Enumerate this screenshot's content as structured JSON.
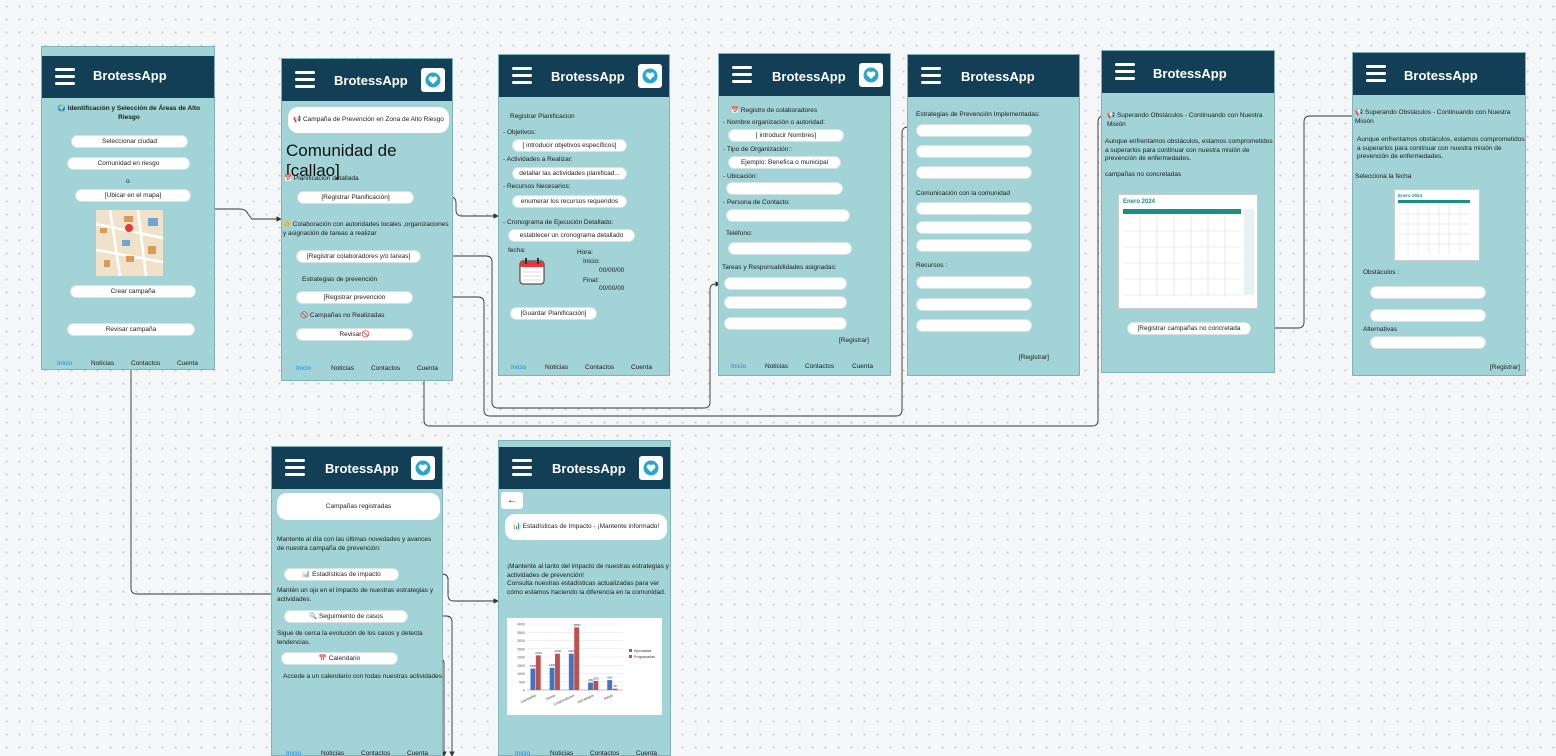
{
  "app_name": "BrotessApp",
  "nav": {
    "inicio": "Inicio",
    "noticias": "Noticias",
    "contactos": "Contactos",
    "cuenta": "Cuenta"
  },
  "colors": {
    "header": "#123f55",
    "screen_bg": "#a2d3d6",
    "active_nav": "#1e88e5"
  },
  "s1": {
    "heading": "🌍 Identificación y Selección de Áreas de Alto Riesgo",
    "btn_city": "Seleccionar ciudad",
    "btn_community": "Comunidad en riesgo",
    "or": "o",
    "btn_map": "[Ubicar en el mapa]",
    "btn_create": "Crear campaña",
    "btn_review": "Revisar campaña"
  },
  "s2": {
    "banner": "📢 Campaña de Prevención en Zona de Alto Riesgo",
    "community": "Comunidad de [callao]",
    "plan_label": "📅 Planificación detallada",
    "btn_plan": "[Registrar Planificación]",
    "collab_label": "🤝 Colaboración con autoridades locales ,organizaciones y asignación de tareas a realizar",
    "btn_collab": "[Registrar colaboradores y/o tareas]",
    "strat_label": "Estrategias de prevención",
    "btn_strat": "[Registrar prevencion",
    "failed_label": "🚫 Campañas no Realizadas",
    "btn_review": "Revisar🚫"
  },
  "s3": {
    "heading": "Registrar Planificacion",
    "obj_label": "- Objetivos:",
    "obj_val": "[ introducir objetivos específicos]",
    "act_label": "- Actividades a Realizar:",
    "act_val": "detallar las actividades planificad...",
    "res_label": "- Recursos Necesarios:",
    "res_val": "enumerar los recursos requeridos",
    "cron_label": "- Cronograma de Ejecución Detallado:",
    "cron_val": "establecer un cronograma detallado",
    "fecha": "fecha:",
    "hora": "Hora:",
    "inicio": "Inicio:",
    "inicio_val": "00/00/00",
    "final": "Final:",
    "final_val": "00/00/00",
    "btn_save": "[Guardar Planificación]"
  },
  "s4": {
    "heading": "📅 Registro de colaboradores",
    "org_label": "- Nombre organización o autoridad:",
    "org_val": "[ introducir Nombres]",
    "type_label": "- Tipo de Organización::",
    "type_val": "Ejemplo: Benefica o municipal",
    "loc_label": "- Ubicación:",
    "contact_label": "- Persona de Contacto:",
    "phone_label": "Teléfono:",
    "tasks_label": "Tareas y Responsabilidades asignadas:",
    "btn_register": "[Registrar]"
  },
  "s5": {
    "strat_label": "Estrategias de Prevención Implementadas:",
    "comm_label": "Comunicación con la comunidad",
    "res_label": "Recursos :",
    "btn_register": "[Registrar]"
  },
  "s6": {
    "heading": "📢 Superando Obstáculos - Continuando con Nuestra Misión",
    "body": "Aunque enfrentamos obstáculos, estamos comprometidos a superarlos para continuar con  nuestra misión de prevención de enfermedades.",
    "failed_label": "campañas no concretadas",
    "cal_title": "Enero 2024",
    "btn_register": "[Registrar campañas no concretada"
  },
  "s7": {
    "heading": "📢 Superando Obstáculos - Continuando con Nuestra Misión",
    "body": "Aunque enfrentamos obstáculos, estamos comprometidos a superarlos para continuar con  nuestra misión de prevención de enfermedades.",
    "date_label": "Selecciona  la fecha",
    "cal_title": "Enero 2024",
    "obst_label": "Obstáculos :",
    "alt_label": "Alternativas",
    "btn_register": "[Registrar]"
  },
  "s8": {
    "card": "Campañas registradas",
    "intro": "Mantente al día con las últimas novedades y avances de nuestra campaña de prevención:",
    "btn_stats": "📊 Estadísticas de impacto",
    "stats_desc": "Mantén un ojo en el impacto de nuestras estrategias y actividades.",
    "btn_cases": "🔍 Seguimiento de casos",
    "cases_desc": "Sigue de cerca la evolución de los casos y detecta tendencias.",
    "btn_cal": "📅 Calendario",
    "cal_desc": "Accede a un calendario con todas nuestras actividades"
  },
  "s9": {
    "back": "←",
    "card": "📊 Estadísticas de Impacto - ¡Mantente informado!",
    "body": "¡Mantente al tanto del impacto de nuestras estrategias y actividades de prevención!\nConsulta nuestras estadísticas actualizadas para ver cómo estamos haciendo la diferencia en la comunidad."
  },
  "chart_data": {
    "type": "bar",
    "categories": [
      "Campañas",
      "Tareas",
      "Colaboradores",
      "Estrategias",
      "Metas"
    ],
    "series": [
      {
        "name": "Ejecutadas",
        "color": "#4472c4",
        "values": [
          1300,
          1350,
          2200,
          450,
          600
        ]
      },
      {
        "name": "Programadas",
        "color": "#c0504d",
        "values": [
          2100,
          2200,
          3800,
          550,
          80
        ]
      }
    ],
    "ylim": [
      0,
      4000
    ],
    "yticks": [
      "0",
      "500",
      "1000",
      "1500",
      "2000",
      "2500",
      "3000",
      "3500",
      "4000"
    ],
    "legend": "right"
  }
}
